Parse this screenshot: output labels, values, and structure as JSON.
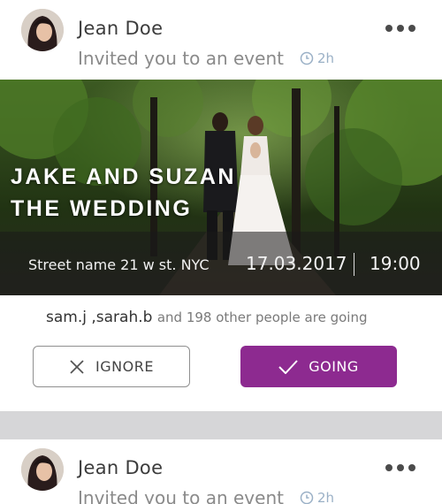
{
  "posts": [
    {
      "author": "Jean Doe",
      "action": "Invited you to an event",
      "time_ago": "2h",
      "event": {
        "title_line1": "JAKE AND SUZAN",
        "title_line2": "THE WEDDING",
        "address": "Street name 21 w st. NYC",
        "date": "17.03.2017",
        "separator": "|",
        "time": "19:00"
      },
      "attendees": {
        "names": "sam.j ,sarah.b",
        "rest": "and 198 other people are going"
      },
      "buttons": {
        "ignore": "IGNORE",
        "going": "GOING"
      }
    },
    {
      "author": "Jean Doe",
      "action": "Invited you to an event",
      "time_ago": "2h"
    }
  ],
  "colors": {
    "accent": "#8d2a90",
    "separator": "#d6d6d8",
    "time_ago": "#9ab0c6"
  },
  "icons": [
    "more-icon",
    "clock-icon",
    "close-icon",
    "check-icon"
  ]
}
